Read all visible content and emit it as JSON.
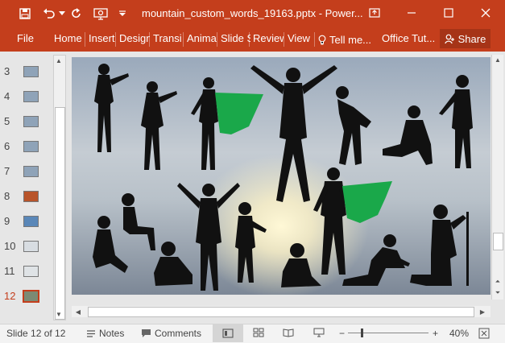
{
  "app": {
    "title": "mountain_custom_words_19163.pptx - Power...",
    "colors": {
      "accent": "#c43e1c",
      "share_bg": "#a8351a",
      "silhouette": "#111111",
      "cape": "#1aa84a"
    }
  },
  "quick_access": {
    "icons": [
      "save-icon",
      "undo-icon",
      "redo-icon",
      "slideshow-icon",
      "customize-icon"
    ]
  },
  "window_controls": {
    "icons": [
      "ribbon-display-icon",
      "minimize-icon",
      "maximize-icon",
      "close-icon"
    ]
  },
  "ribbon": {
    "file": "File",
    "tabs": [
      "Home",
      "Insert",
      "Design",
      "Transi",
      "Anima",
      "Slide S",
      "Review",
      "View"
    ],
    "tell_me": "Tell me...",
    "office_tut": "Office Tut...",
    "share": "Share"
  },
  "thumbnails": {
    "numbers": [
      "3",
      "4",
      "5",
      "6",
      "7",
      "8",
      "9",
      "10",
      "11",
      "12"
    ],
    "active": "12"
  },
  "statusbar": {
    "slide_info": "Slide 12 of 12",
    "notes": "Notes",
    "comments": "Comments",
    "zoom": "40%"
  }
}
